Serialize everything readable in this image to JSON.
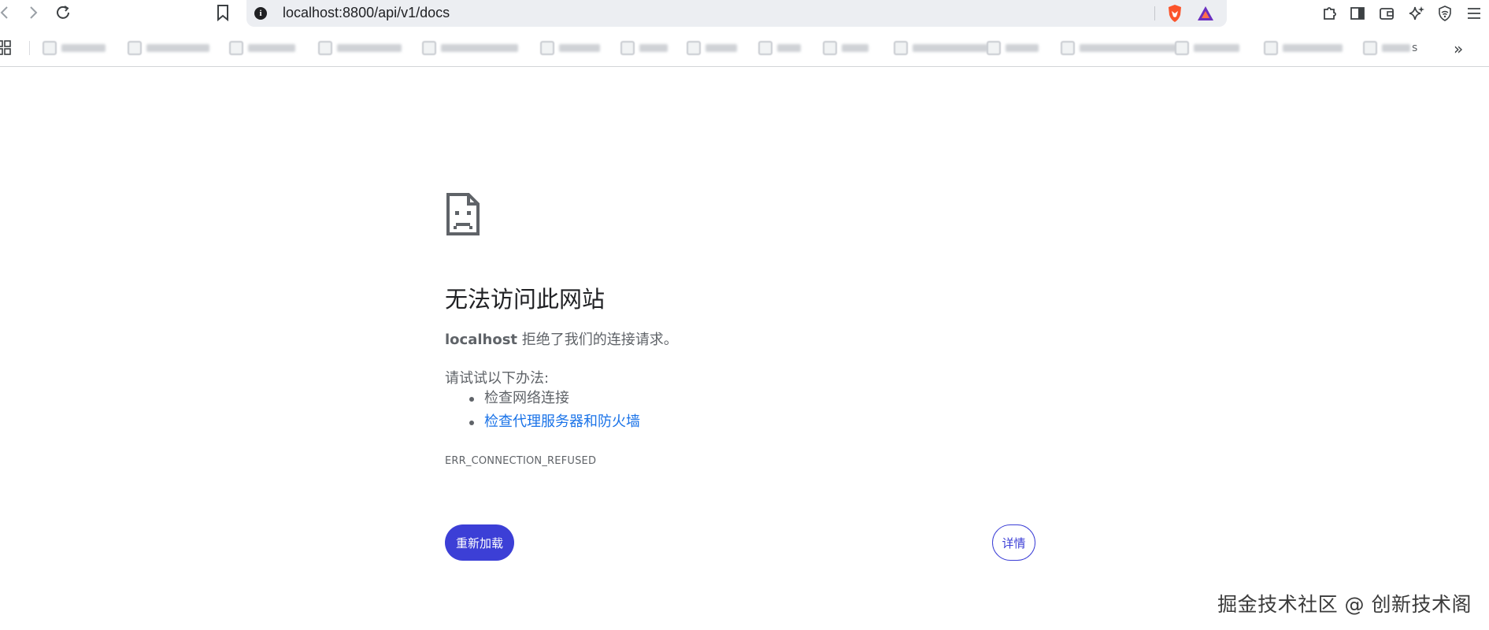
{
  "browser": {
    "url": "localhost:8800/api/v1/docs",
    "bookmarks_more": "»",
    "bookmark_count": 16,
    "bookmarks_last_visible_suffix": "s"
  },
  "error_page": {
    "title": "无法访问此网站",
    "host": "localhost",
    "description_suffix": " 拒绝了我们的连接请求。",
    "try_heading": "请试试以下办法:",
    "suggestions": [
      {
        "text": "检查网络连接",
        "is_link": false
      },
      {
        "text": "检查代理服务器和防火墙",
        "is_link": true
      }
    ],
    "error_code": "ERR_CONNECTION_REFUSED",
    "reload_label": "重新加载",
    "details_label": "详情"
  },
  "watermark": "掘金技术社区 @ 创新技术阁",
  "colors": {
    "primary_button": "#3c3fd6",
    "link": "#1a73e8",
    "text_secondary": "#5f6368",
    "omnibox_bg": "#eceef2"
  },
  "icons": {
    "back": "back-arrow-icon",
    "forward": "forward-arrow-icon",
    "reload": "reload-icon",
    "bookmark": "bookmark-icon",
    "site_info": "info-icon",
    "brave": "brave-shield-icon",
    "rewards": "brave-rewards-icon",
    "extensions": "puzzle-icon",
    "sidebar": "sidebar-icon",
    "wallet": "wallet-icon",
    "leo": "sparkle-icon",
    "vpn": "vpn-shield-icon",
    "menu": "hamburger-menu-icon",
    "apps": "apps-grid-icon",
    "error": "sad-document-icon"
  }
}
